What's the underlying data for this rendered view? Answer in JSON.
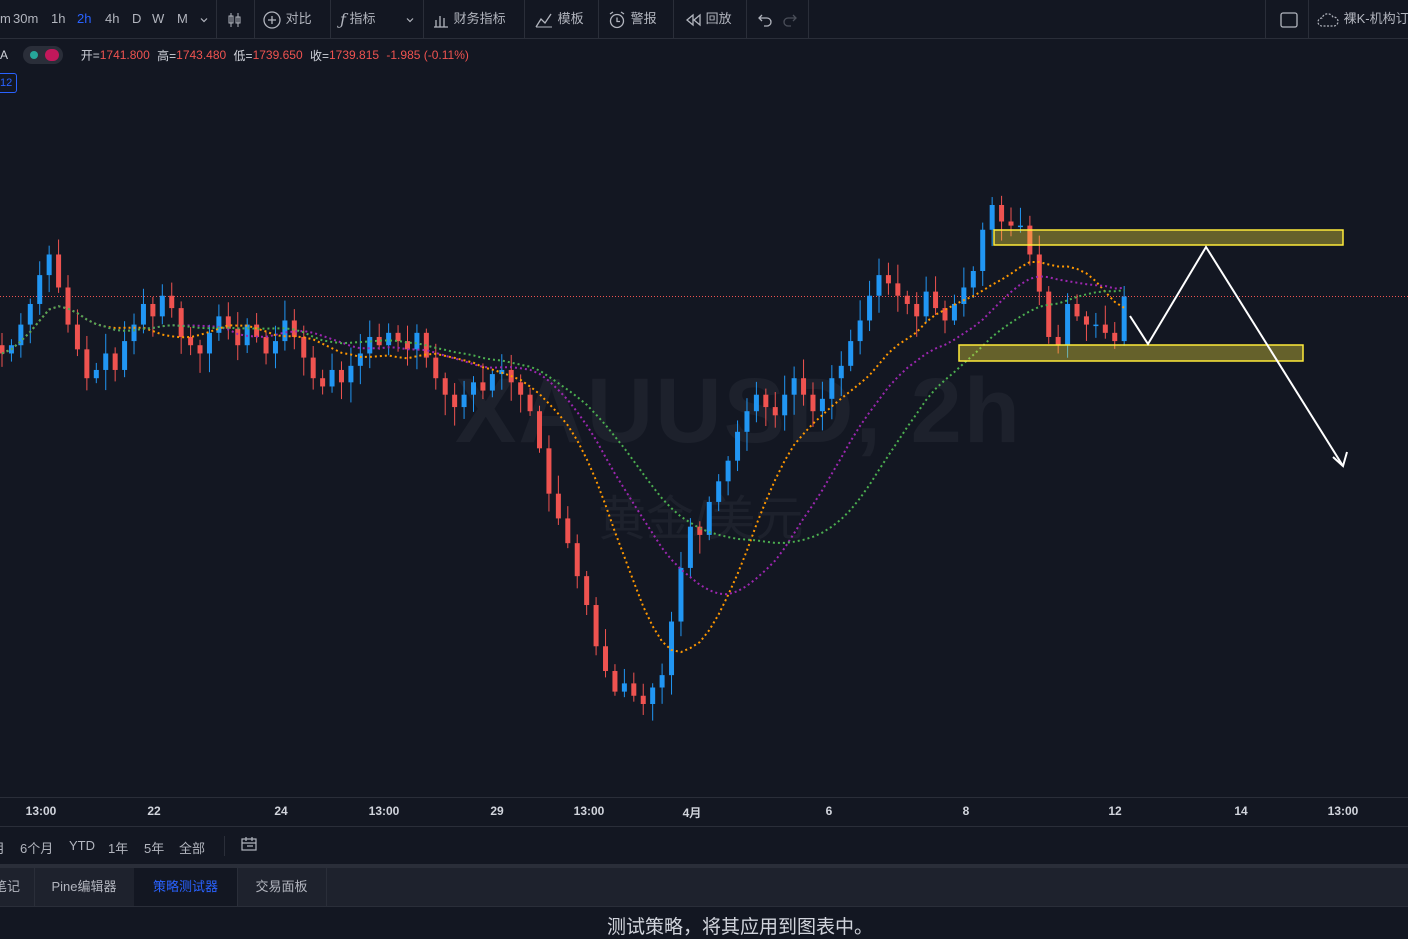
{
  "toolbar": {
    "intervals": [
      "m",
      "30m",
      "1h",
      "2h",
      "4h",
      "D",
      "W",
      "M"
    ],
    "active_interval": "2h",
    "compare_label": "对比",
    "indicators_label": "指标",
    "financials_label": "财务指标",
    "templates_label": "模板",
    "alert_label": "警报",
    "replay_label": "回放",
    "account_label": "裸K-机构订"
  },
  "legend": {
    "symbol_fragment": "A",
    "open_label": "开=",
    "open": "1741.800",
    "high_label": "高=",
    "high": "1743.480",
    "low_label": "低=",
    "low": "1739.650",
    "close_label": "收=",
    "close": "1739.815",
    "change": "-1.985",
    "change_pct": "(-0.11%)",
    "study_tag": "12"
  },
  "watermark": {
    "symbol": "XAUUSD, 2h",
    "description": "黄金/美元"
  },
  "xaxis": {
    "ticks": [
      "13:00",
      "22",
      "24",
      "13:00",
      "29",
      "13:00",
      "4月",
      "6",
      "8",
      "12",
      "14",
      "13:00"
    ]
  },
  "ranges": [
    "月",
    "6个月",
    "YTD",
    "1年",
    "5年",
    "全部"
  ],
  "bottom_tabs": [
    "笔记",
    "Pine编辑器",
    "策略测试器",
    "交易面板"
  ],
  "active_tab": "策略测试器",
  "bottom_message": "测试策略，将其应用到图表中。",
  "colors": {
    "up": "#2196f3",
    "down": "#ef5350",
    "ma_orange": "#ff9800",
    "ma_purple": "#9c27b0",
    "ma_green": "#4caf50",
    "zone": "#ffeb3b",
    "accent": "#2962ff"
  },
  "chart_data": {
    "type": "candlestick",
    "symbol": "XAUUSD",
    "timeframe": "2h",
    "last_price": 1739.815,
    "closes": [
      1726,
      1728,
      1733,
      1738,
      1745,
      1750,
      1742,
      1733,
      1727,
      1720,
      1722,
      1726,
      1722,
      1729,
      1733,
      1738,
      1735,
      1740,
      1737,
      1730,
      1728,
      1726,
      1731,
      1735,
      1732,
      1728,
      1733,
      1730,
      1726,
      1729,
      1734,
      1730,
      1725,
      1720,
      1718,
      1722,
      1719,
      1723,
      1726,
      1730,
      1728,
      1731,
      1729,
      1727,
      1731,
      1725,
      1720,
      1716,
      1713,
      1716,
      1719,
      1717,
      1721,
      1722,
      1719,
      1716,
      1712,
      1703,
      1692,
      1686,
      1680,
      1672,
      1665,
      1655,
      1649,
      1644,
      1646,
      1643,
      1641,
      1645,
      1648,
      1661,
      1674,
      1684,
      1682,
      1690,
      1695,
      1700,
      1707,
      1712,
      1716,
      1713,
      1711,
      1716,
      1720,
      1716,
      1712,
      1715,
      1720,
      1723,
      1729,
      1734,
      1740,
      1745,
      1743,
      1740,
      1738,
      1735,
      1741,
      1737,
      1734,
      1738,
      1742,
      1746,
      1756,
      1762,
      1758,
      1757,
      1757,
      1750,
      1741,
      1730,
      1728,
      1738,
      1735,
      1733,
      1733,
      1731,
      1729,
      1739.8
    ]
  }
}
